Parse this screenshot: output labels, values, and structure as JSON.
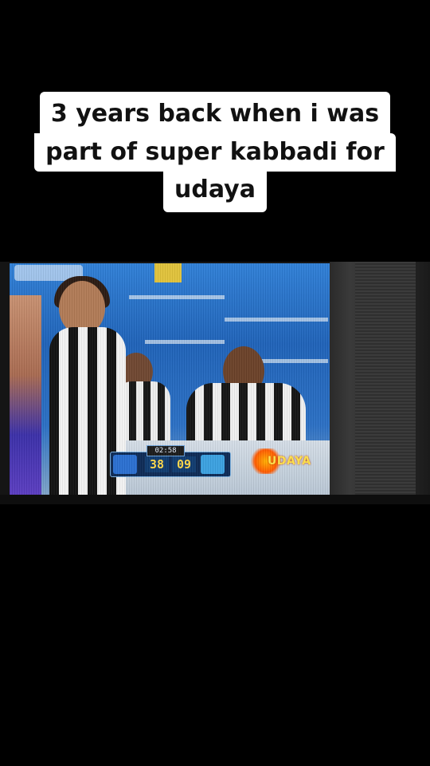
{
  "caption": {
    "line1": "3 years back when i was",
    "line2": "part of super kabbadi for",
    "line3": "udaya"
  },
  "photo": {
    "scoreboard": {
      "timer": "02:58",
      "score_left": "38",
      "score_right": "09"
    },
    "channel_logo_text": "UDAYA"
  }
}
